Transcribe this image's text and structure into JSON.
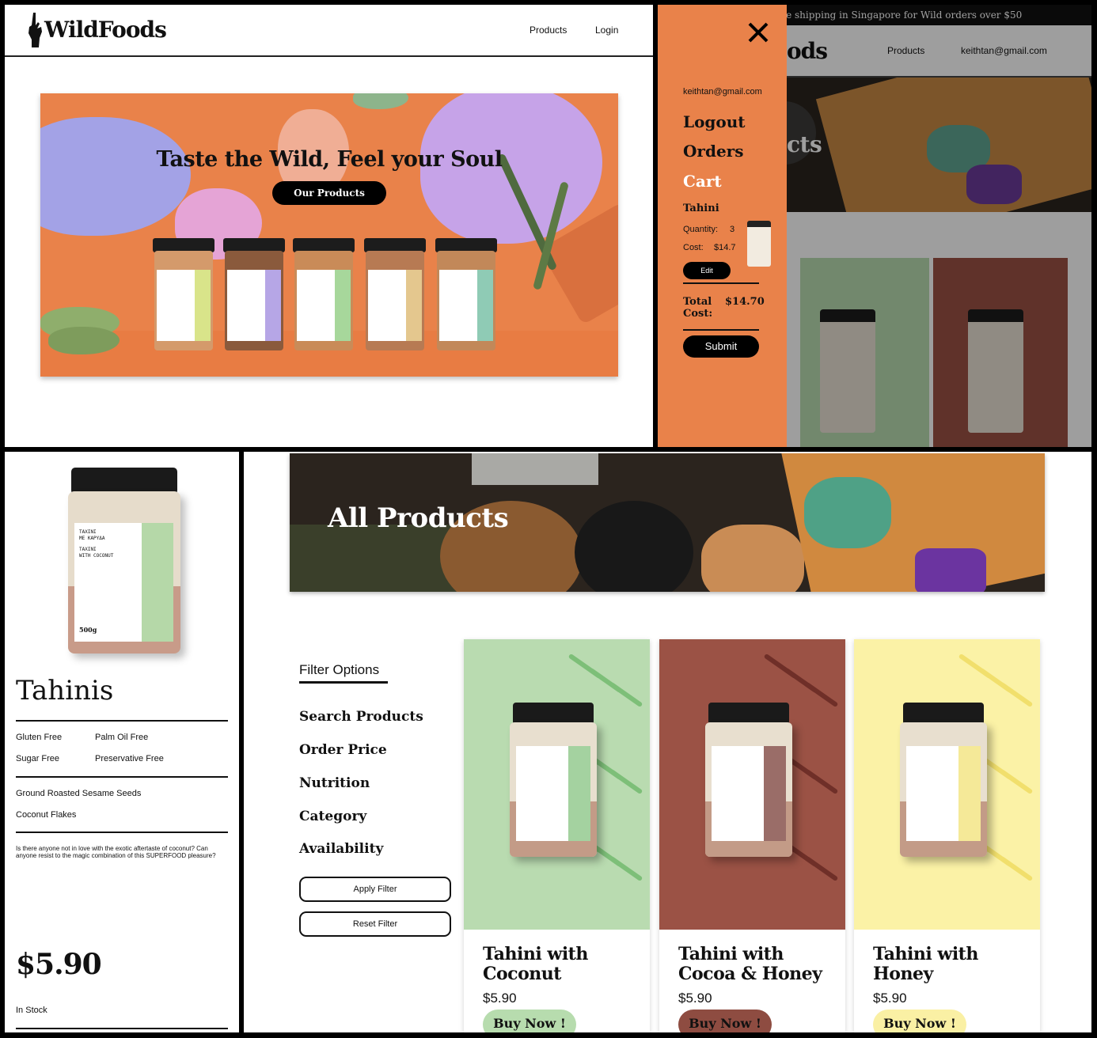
{
  "home": {
    "brand": "WildFoods",
    "nav": {
      "products": "Products",
      "login": "Login"
    },
    "hero_title": "Taste the Wild, Feel your Soul",
    "hero_button": "Our Products"
  },
  "menu_overlay": {
    "promo": "ee shipping in Singapore for Wild orders over $50",
    "bg_brand_fragment": "ods",
    "bg_nav": {
      "products": "Products",
      "email": "keithtan@gmail.com"
    },
    "bg_banner_fragment": "cts",
    "email": "keithtan@gmail.com",
    "links": {
      "logout": "Logout",
      "orders": "Orders",
      "cart": "Cart"
    },
    "cart_item": {
      "name": "Tahini",
      "quantity_label": "Quantity:",
      "quantity": "3",
      "cost_label": "Cost:",
      "cost": "$14.7",
      "edit": "Edit"
    },
    "total_label": "Total Cost:",
    "total_value": "$14.70",
    "submit": "Submit",
    "colors": {
      "menu_bg": "#e9824a"
    }
  },
  "detail": {
    "title": "Tahinis",
    "tags": [
      "Gluten Free",
      "Palm Oil Free",
      "Sugar Free",
      "Preservative Free"
    ],
    "ingredients": [
      "Ground Roasted Sesame Seeds",
      "Coconut Flakes"
    ],
    "description": "Is there anyone not in love with the exotic aftertaste of coconut? Can anyone resist to the magic combination of this SUPERFOOD pleasure?",
    "price": "$5.90",
    "stock": "In Stock",
    "jar_label": {
      "line1": "ΤΑΧΙΝΙ",
      "line2": "ΜΕ ΚΑΡΥΔΑ",
      "line3": "ΤΑΧΙΝΙ",
      "line4": "WITH COCONUT",
      "weight": "500g"
    }
  },
  "catalog": {
    "banner_title": "All Products",
    "filter_heading": "Filter Options",
    "filters": [
      "Search Products",
      "Order Price",
      "Nutrition",
      "Category",
      "Availability"
    ],
    "apply": "Apply Filter",
    "reset": "Reset Filter",
    "products": [
      {
        "name": "Tahini with Coconut",
        "price": "$5.90",
        "buy": "Buy Now !",
        "bg": "#b9dbb0",
        "accent": "#7dbf78",
        "btn": "#b7dcae"
      },
      {
        "name": "Tahini with Cocoa & Honey",
        "price": "$5.90",
        "buy": "Buy Now !",
        "bg": "#9b5245",
        "accent": "#6f2f28",
        "btn": "#8e4c41"
      },
      {
        "name": "Tahini with Honey",
        "price": "$5.90",
        "buy": "Buy Now !",
        "bg": "#fbf2a6",
        "accent": "#f1df6c",
        "btn": "#faf0a4"
      }
    ]
  },
  "icons": [
    "crossed-fingers-logo-icon",
    "close-icon"
  ]
}
